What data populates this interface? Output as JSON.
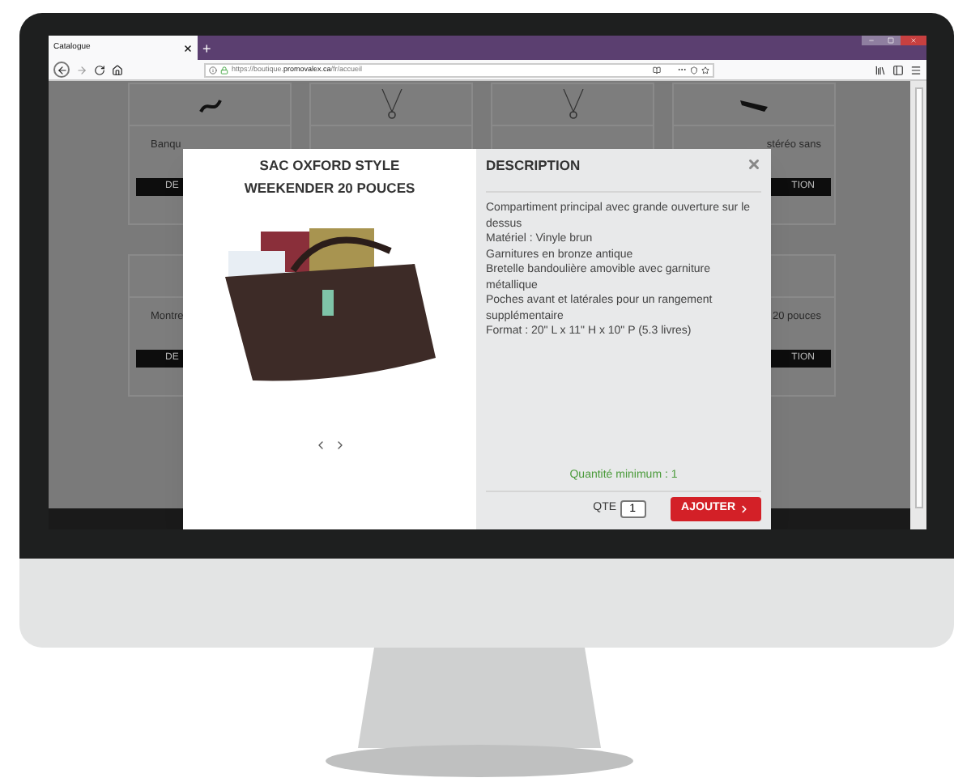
{
  "browser": {
    "tab_title": "Catalogue",
    "new_tab": "+",
    "url_prefix": "https://boutique.",
    "url_domain": "promovalex.ca",
    "url_path": "/fr/accueil"
  },
  "background_cards": {
    "top_row": {
      "left": {
        "title": "Banqu",
        "button": "DE"
      },
      "right": {
        "title": "stéréo sans",
        "button": "TION"
      }
    },
    "bottom_row": {
      "left": {
        "title": "Montre",
        "button": "DE"
      },
      "right": {
        "title": "20 pouces",
        "button": "TION"
      }
    }
  },
  "modal": {
    "product_title": "SAC OXFORD STYLE WEEKENDER 20 POUCES",
    "heading": "DESCRIPTION",
    "description": [
      "Compartiment principal avec grande ouverture sur le dessus",
      "Matériel : Vinyle brun",
      "Garnitures en bronze antique",
      "Bretelle bandoulière amovible avec garniture métallique",
      "Poches avant et latérales pour un rangement supplémentaire",
      "Format : 20\" L x 11\" H x 10\" P (5.3 livres)"
    ],
    "minimum": "Quantité minimum : 1",
    "qty_label": "QTE",
    "qty_value": "1",
    "add_button": "AJOUTER"
  }
}
